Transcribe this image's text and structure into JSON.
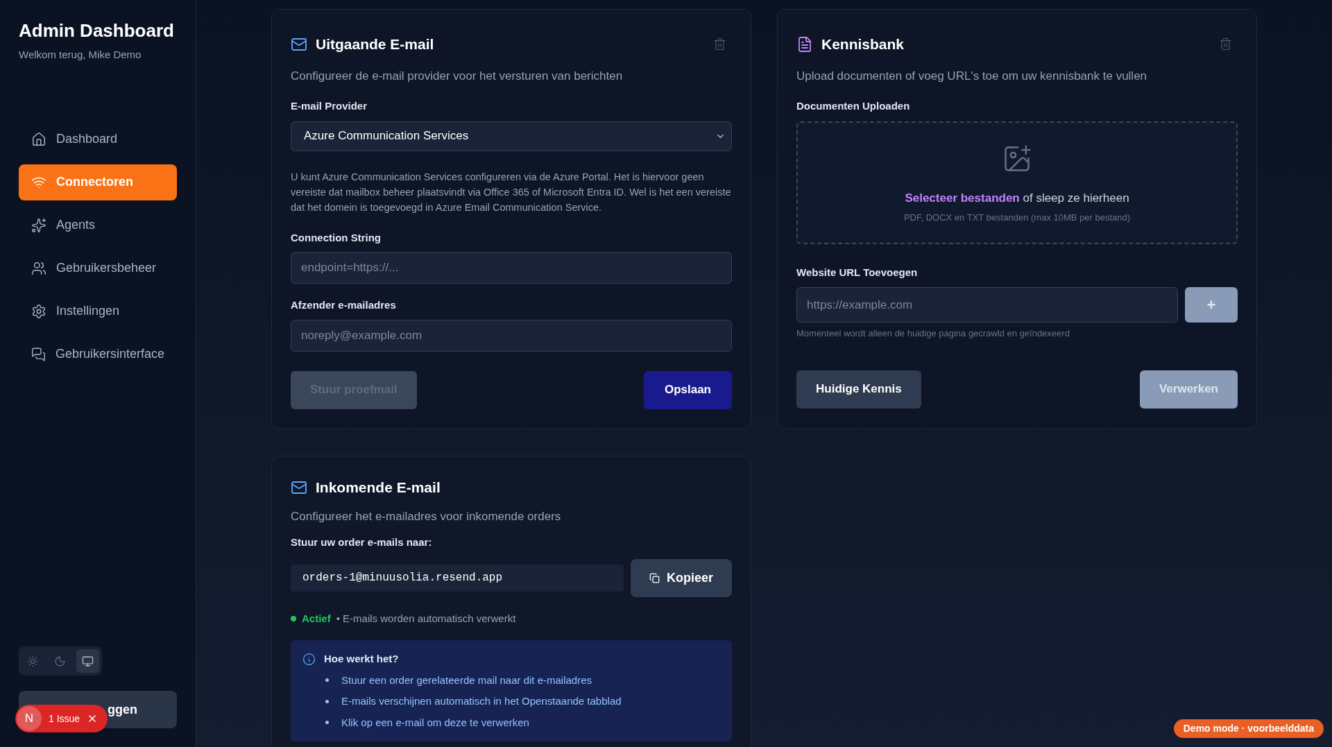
{
  "sidebar": {
    "title": "Admin Dashboard",
    "subtitle": "Welkom terug, Mike Demo",
    "nav": [
      {
        "label": "Dashboard",
        "kind": "home",
        "selected": false
      },
      {
        "label": "Connectoren",
        "kind": "wifi",
        "selected": true
      },
      {
        "label": "Agents",
        "kind": "sparkles",
        "selected": false
      },
      {
        "label": "Gebruikersbeheer",
        "kind": "users",
        "selected": false
      },
      {
        "label": "Instellingen",
        "kind": "settings",
        "selected": false
      },
      {
        "label": "Gebruikersinterface",
        "kind": "chat",
        "selected": false
      }
    ],
    "theme_toggle": [
      {
        "kind": "sun",
        "selected": false
      },
      {
        "kind": "moon",
        "selected": false
      },
      {
        "kind": "monitor",
        "selected": true
      }
    ],
    "logout": {
      "label": "ggen"
    }
  },
  "issue_badge": {
    "initial": "N",
    "label": "1 Issue"
  },
  "outgoing_email": {
    "title": "Uitgaande E-mail",
    "description": "Configureer de e-mail provider voor het versturen van berichten",
    "provider_label": "E-mail Provider",
    "provider_value": "Azure Communication Services",
    "help": "U kunt Azure Communication Services configureren via de Azure Portal. Het is hiervoor geen vereiste dat mailbox beheer plaatsvindt via Office 365 of Microsoft Entra ID. Wel is het een vereiste dat het domein is toegevoegd in Azure Email Communication Service.",
    "fields": [
      {
        "label": "Connection String",
        "placeholder": "endpoint=https://..."
      },
      {
        "label": "Afzender e-mailadres",
        "placeholder": "noreply@example.com"
      }
    ],
    "test_button": {
      "label": "Stuur proefmail",
      "disabled": true
    },
    "save_button": {
      "label": "Opslaan",
      "disabled": false
    }
  },
  "knowledge_base": {
    "title": "Kennisbank",
    "description": "Upload documenten of voeg URL's toe om uw kennisbank te vullen",
    "upload_label": "Documenten Uploaden",
    "dropzone": {
      "link": "Selecteer bestanden",
      "text": "of sleep ze hierheen",
      "hint": "PDF, DOCX en TXT bestanden (max 10MB per bestand)"
    },
    "url_label": "Website URL Toevoegen",
    "url_placeholder": "https://example.com",
    "add_button": {
      "label": "+",
      "disabled": true
    },
    "url_hint": "Momenteel wordt alleen de huidige pagina gecrawld en geïndexeerd",
    "current_button": {
      "label": "Huidige Kennis",
      "disabled": false
    },
    "process_button": {
      "label": "Verwerken",
      "disabled": true
    }
  },
  "incoming_email": {
    "title": "Inkomende E-mail",
    "description": "Configureer het e-mailadres voor inkomende orders",
    "address_label": "Stuur uw order e-mails naar:",
    "address": "orders-1@minuusolia.resend.app",
    "copy_button": "Kopieer",
    "status": {
      "active": true,
      "label": "Actief",
      "text": "• E-mails worden automatisch verwerkt"
    },
    "info": {
      "title": "Hoe werkt het?",
      "items": [
        "Stuur een order gerelateerde mail naar dit e-mailadres",
        "E-mails verschijnen automatisch in het Openstaande tabblad",
        "Klik op een e-mail om deze te verwerken"
      ]
    }
  },
  "demo_badge": "Demo mode · voorbeelddata"
}
